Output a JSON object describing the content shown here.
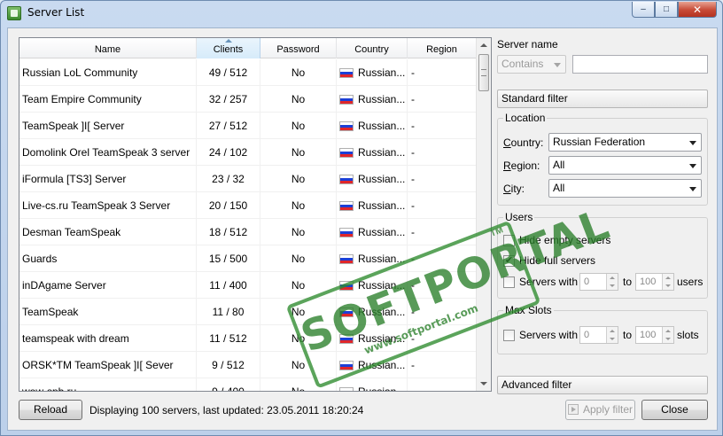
{
  "window": {
    "title": "Server List",
    "icon": "app-icon",
    "caption": {
      "minimize": "‒",
      "maximize": "□",
      "close": "✕"
    }
  },
  "table": {
    "columns": [
      {
        "key": "name",
        "label": "Name"
      },
      {
        "key": "clients",
        "label": "Clients",
        "sorted": true
      },
      {
        "key": "password",
        "label": "Password"
      },
      {
        "key": "country",
        "label": "Country"
      },
      {
        "key": "region",
        "label": "Region"
      }
    ],
    "rows": [
      {
        "name": "Russian LoL Community",
        "clients": "49 / 512",
        "password": "No",
        "country": "Russian...",
        "region": "-"
      },
      {
        "name": "Team Empire Community",
        "clients": "32 / 257",
        "password": "No",
        "country": "Russian...",
        "region": "-"
      },
      {
        "name": "TeamSpeak ]I[ Server",
        "clients": "27 / 512",
        "password": "No",
        "country": "Russian...",
        "region": "-"
      },
      {
        "name": "Domolink Orel TeamSpeak 3 server",
        "clients": "24 / 102",
        "password": "No",
        "country": "Russian...",
        "region": "-"
      },
      {
        "name": "iFormula [TS3] Server",
        "clients": "23 / 32",
        "password": "No",
        "country": "Russian...",
        "region": "-"
      },
      {
        "name": "Live-cs.ru TeamSpeak 3 Server",
        "clients": "20 / 150",
        "password": "No",
        "country": "Russian...",
        "region": "-"
      },
      {
        "name": "Desman TeamSpeak",
        "clients": "18 / 512",
        "password": "No",
        "country": "Russian...",
        "region": "-"
      },
      {
        "name": "Guards",
        "clients": "15 / 500",
        "password": "No",
        "country": "Russian...",
        "region": "-"
      },
      {
        "name": "inDAgame Server",
        "clients": "11 / 400",
        "password": "No",
        "country": "Russian...",
        "region": "-"
      },
      {
        "name": "TeamSpeak",
        "clients": "11 / 80",
        "password": "No",
        "country": "Russian...",
        "region": "-"
      },
      {
        "name": "teamspeak with dream",
        "clients": "11 / 512",
        "password": "No",
        "country": "Russian...",
        "region": "-"
      },
      {
        "name": "ORSK*TM TeamSpeak ]I[ Sever",
        "clients": "9 / 512",
        "password": "No",
        "country": "Russian...",
        "region": "-"
      },
      {
        "name": "wow-spb.ru",
        "clients": "9 / 400",
        "password": "No",
        "country": "Russian...",
        "region": "-"
      }
    ]
  },
  "filter": {
    "server_name_label": "Server name",
    "match_mode": "Contains",
    "server_name_value": "",
    "standard_filter_label": "Standard filter",
    "location": {
      "title": "Location",
      "country_label": "Country:",
      "country_value": "Russian Federation",
      "region_label": "Region:",
      "region_value": "All",
      "city_label": "City:",
      "city_value": "All"
    },
    "users": {
      "title": "Users",
      "hide_empty_label": "Hide empty servers",
      "hide_empty_checked": false,
      "hide_full_label": "Hide full servers",
      "hide_full_checked": true,
      "servers_with_label": "Servers with",
      "min_users": "0",
      "to_label": "to",
      "max_users": "100",
      "unit": "users"
    },
    "max_slots": {
      "title": "Max Slots",
      "servers_with_label": "Servers with",
      "min_slots": "0",
      "to_label": "to",
      "max_slots": "100",
      "unit": "slots"
    },
    "advanced_filter_label": "Advanced filter"
  },
  "footer": {
    "reload_label": "Reload",
    "status_text": "Displaying 100 servers, last updated: 23.05.2011 18:20:24",
    "apply_label": "Apply filter",
    "close_label": "Close"
  },
  "watermark": {
    "brand": "SOFTPORTAL",
    "url": "www.softportal.com",
    "tm": "TM",
    "color": "#2a7f2a"
  }
}
